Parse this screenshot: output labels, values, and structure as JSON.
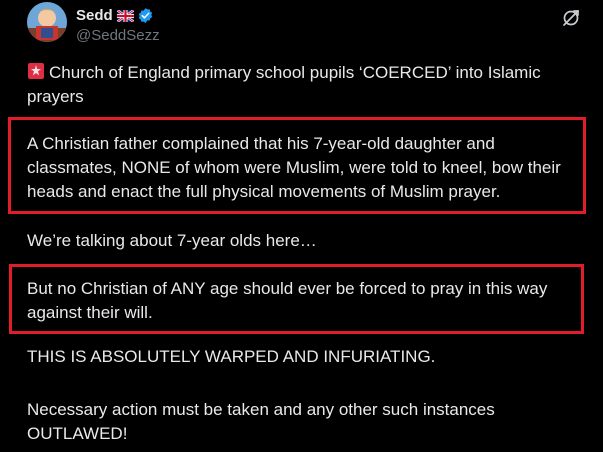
{
  "author": {
    "display_name": "Sedd",
    "flag": "🇬🇧",
    "handle": "@SeddSezz",
    "verified": true
  },
  "paragraphs": {
    "p1": "Church of England primary school pupils ‘COERCED’ into Islamic prayers",
    "p2": "A Christian father complained that his 7-year-old daughter and classmates, NONE of whom were Muslim, were told to kneel, bow their heads and enact the full physical movements of Muslim prayer.",
    "p3": "We’re talking about 7-year olds here…",
    "p4": "But no Christian of ANY age should ever be forced to pray in this way against their will.",
    "p5": "THIS IS ABSOLUTELY WARPED AND INFURIATING.",
    "p6": "Necessary action must be taken and any other such instances OUTLAWED!"
  },
  "icons": {
    "verified": "verified-badge-icon",
    "grok": "grok-icon",
    "siren": "siren-emoji-icon"
  },
  "colors": {
    "background": "#000000",
    "text": "#e7e9ea",
    "muted": "#71767b",
    "verified": "#1d9bf0",
    "highlight_box": "#e11d2a"
  }
}
